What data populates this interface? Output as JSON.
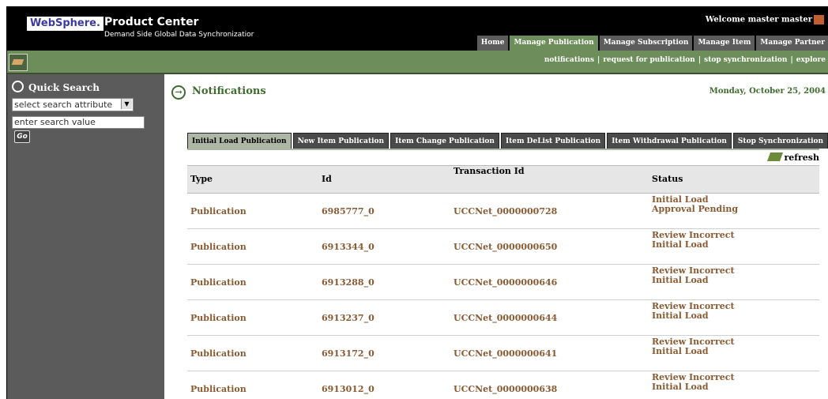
{
  "header": {
    "logo": "WebSphere.",
    "product": "Product Center",
    "subtitle": "Demand Side Global Data Synchronizatior",
    "welcome": "Welcome master master",
    "nav": [
      {
        "label": "Home"
      },
      {
        "label": "Manage Publication"
      },
      {
        "label": "Manage Subscription"
      },
      {
        "label": "Manage Item"
      },
      {
        "label": "Manage Partner"
      }
    ],
    "sublinks": [
      "notifications",
      "request for publication",
      "stop synchronization",
      "explore"
    ]
  },
  "sidebar": {
    "title": "Quick Search",
    "attribute_select": "select search attribute",
    "value_placeholder": "enter search value",
    "go": "Go"
  },
  "main": {
    "title": "Notifications",
    "date": "Monday, October 25, 2004",
    "tabs": [
      {
        "label": "Initial Load Publication"
      },
      {
        "label": "New Item Publication"
      },
      {
        "label": "Item Change Publication"
      },
      {
        "label": "Item DeList Publication"
      },
      {
        "label": "Item Withdrawal Publication"
      },
      {
        "label": "Stop Synchronization"
      }
    ],
    "refresh": "refresh",
    "columns": [
      "Type",
      "Id",
      "Transaction Id",
      "Status"
    ],
    "rows": [
      {
        "type": "Publication",
        "id": "6985777_0",
        "txn": "UCCNet_0000000728",
        "status": "Initial Load Approval Pending"
      },
      {
        "type": "Publication",
        "id": "6913344_0",
        "txn": "UCCNet_0000000650",
        "status": "Review Incorrect Initial Load"
      },
      {
        "type": "Publication",
        "id": "6913288_0",
        "txn": "UCCNet_0000000646",
        "status": "Review Incorrect Initial Load"
      },
      {
        "type": "Publication",
        "id": "6913237_0",
        "txn": "UCCNet_0000000644",
        "status": "Review Incorrect Initial Load"
      },
      {
        "type": "Publication",
        "id": "6913172_0",
        "txn": "UCCNet_0000000641",
        "status": "Review Incorrect Initial Load"
      },
      {
        "type": "Publication",
        "id": "6913012_0",
        "txn": "UCCNet_0000000638",
        "status": "Review Incorrect Initial Load"
      }
    ]
  },
  "colors": {
    "header_bg": "#000000",
    "accent_green": "#6d8e5a",
    "sidebar_bg": "#5b5b5b",
    "link_brown": "#8a5a32",
    "title_green": "#3e6b2e"
  }
}
